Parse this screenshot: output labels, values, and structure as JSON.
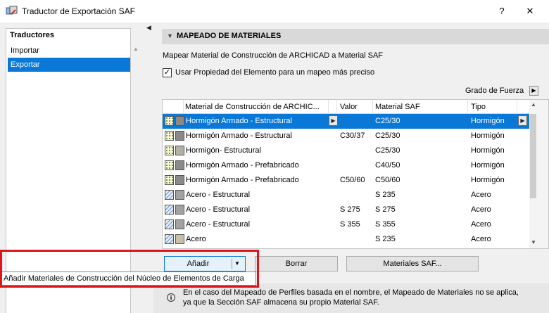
{
  "window": {
    "title": "Traductor de Exportación SAF",
    "help": "?",
    "close": "✕"
  },
  "sidebar": {
    "header": "Traductores",
    "items": [
      {
        "label": "Importar",
        "selected": false
      },
      {
        "label": "Exportar",
        "selected": true
      }
    ]
  },
  "section": {
    "title": "MAPEADO DE MATERIALES"
  },
  "description": "Mapear Material de Construcción de ARCHICAD a Material SAF",
  "checkbox": {
    "checked": true,
    "label": "Usar Propiedad del Elemento para un mapeo más preciso"
  },
  "grado_fuerza": {
    "label": "Grado de Fuerza"
  },
  "table": {
    "headers": [
      "Material de Construcción de ARCHIC...",
      "Valor",
      "Material SAF",
      "Tipo"
    ],
    "rows": [
      {
        "material": "Hormigón Armado - Estructural",
        "valor": "",
        "saf": "C25/30",
        "tipo": "Hormigón",
        "kind": "concrete",
        "color": "#8a8a8a",
        "selected": true
      },
      {
        "material": "Hormigón Armado - Estructural",
        "valor": "C30/37",
        "saf": "C25/30",
        "tipo": "Hormigón",
        "kind": "concrete",
        "color": "#8a8a8a",
        "selected": false
      },
      {
        "material": "Hormigón- Estructural",
        "valor": "",
        "saf": "C25/30",
        "tipo": "Hormigón",
        "kind": "concrete",
        "color": "#b4b0a4",
        "selected": false
      },
      {
        "material": "Hormigón Armado - Prefabricado",
        "valor": "",
        "saf": "C40/50",
        "tipo": "Hormigón",
        "kind": "concrete",
        "color": "#8a8a8a",
        "selected": false
      },
      {
        "material": "Hormigón Armado - Prefabricado",
        "valor": "C50/60",
        "saf": "C50/60",
        "tipo": "Hormigón",
        "kind": "concrete",
        "color": "#8a8a8a",
        "selected": false
      },
      {
        "material": "Acero - Estructural",
        "valor": "",
        "saf": "S 235",
        "tipo": "Acero",
        "kind": "steel",
        "color": "#a2a2a2",
        "selected": false
      },
      {
        "material": "Acero - Estructural",
        "valor": "S 275",
        "saf": "S 275",
        "tipo": "Acero",
        "kind": "steel",
        "color": "#a2a2a2",
        "selected": false
      },
      {
        "material": "Acero - Estructural",
        "valor": "S 355",
        "saf": "S 355",
        "tipo": "Acero",
        "kind": "steel",
        "color": "#a2a2a2",
        "selected": false
      },
      {
        "material": "Acero",
        "valor": "",
        "saf": "S 235",
        "tipo": "Acero",
        "kind": "steel",
        "color": "#c9bea6",
        "selected": false
      }
    ]
  },
  "buttons": {
    "add": "Añadir",
    "delete": "Borrar",
    "saf_materials": "Materiales SAF..."
  },
  "dropdown": {
    "item": "Añadir Materiales de Construcción del Núcleo de Elementos de Carga"
  },
  "info": {
    "line1": "En el caso del Mapeado de Perfiles basada en el nombre, el Mapeado de Materiales no se aplica,",
    "line2": "ya que la Sección SAF almacena su propio Material SAF."
  }
}
